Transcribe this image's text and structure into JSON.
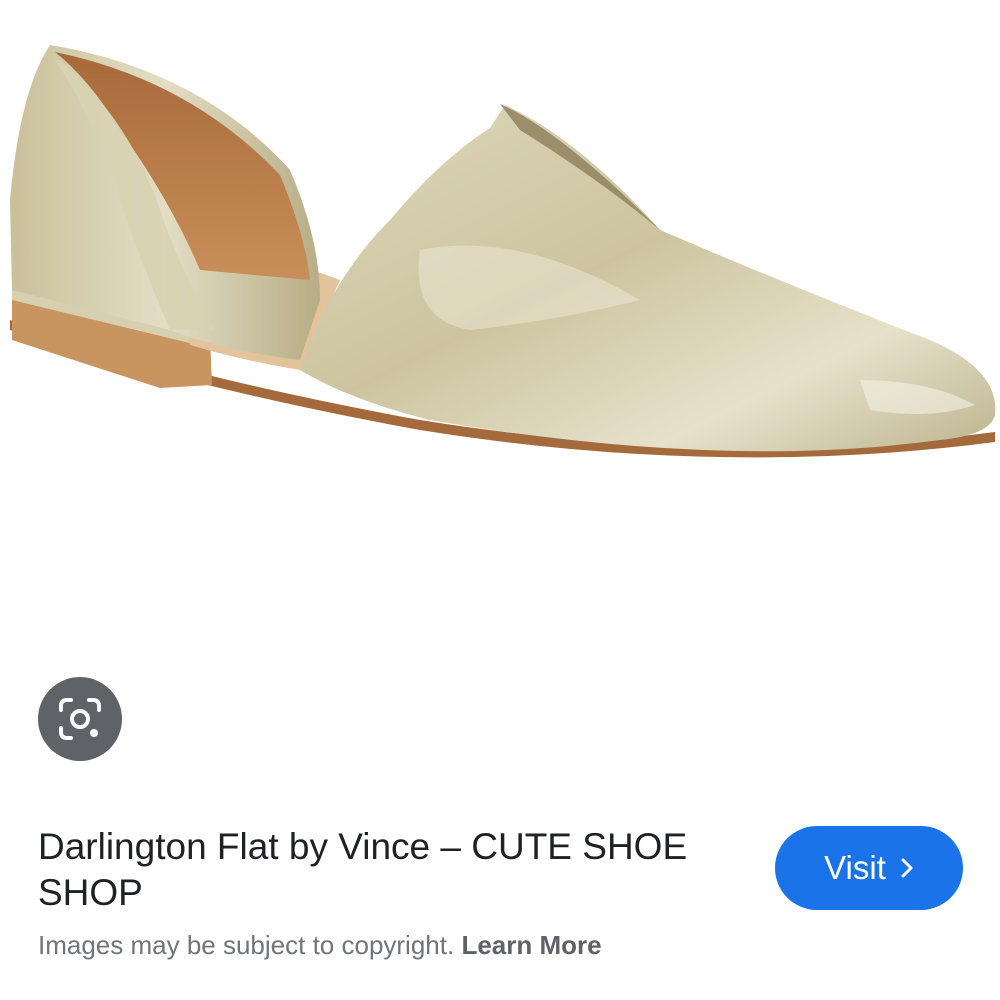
{
  "result": {
    "title": "Darlington Flat by Vince – CUTE SHOE SHOP",
    "visit_label": "Visit",
    "visit_icon": "chevron-right-icon",
    "lens_icon": "google-lens-icon",
    "notice_text": "Images may be subject to copyright.",
    "learn_more_label": "Learn More"
  },
  "colors": {
    "visit_button": "#1a73e8",
    "lens_button": "#5f6368",
    "title_text": "#202124",
    "notice_text": "#70757a"
  }
}
